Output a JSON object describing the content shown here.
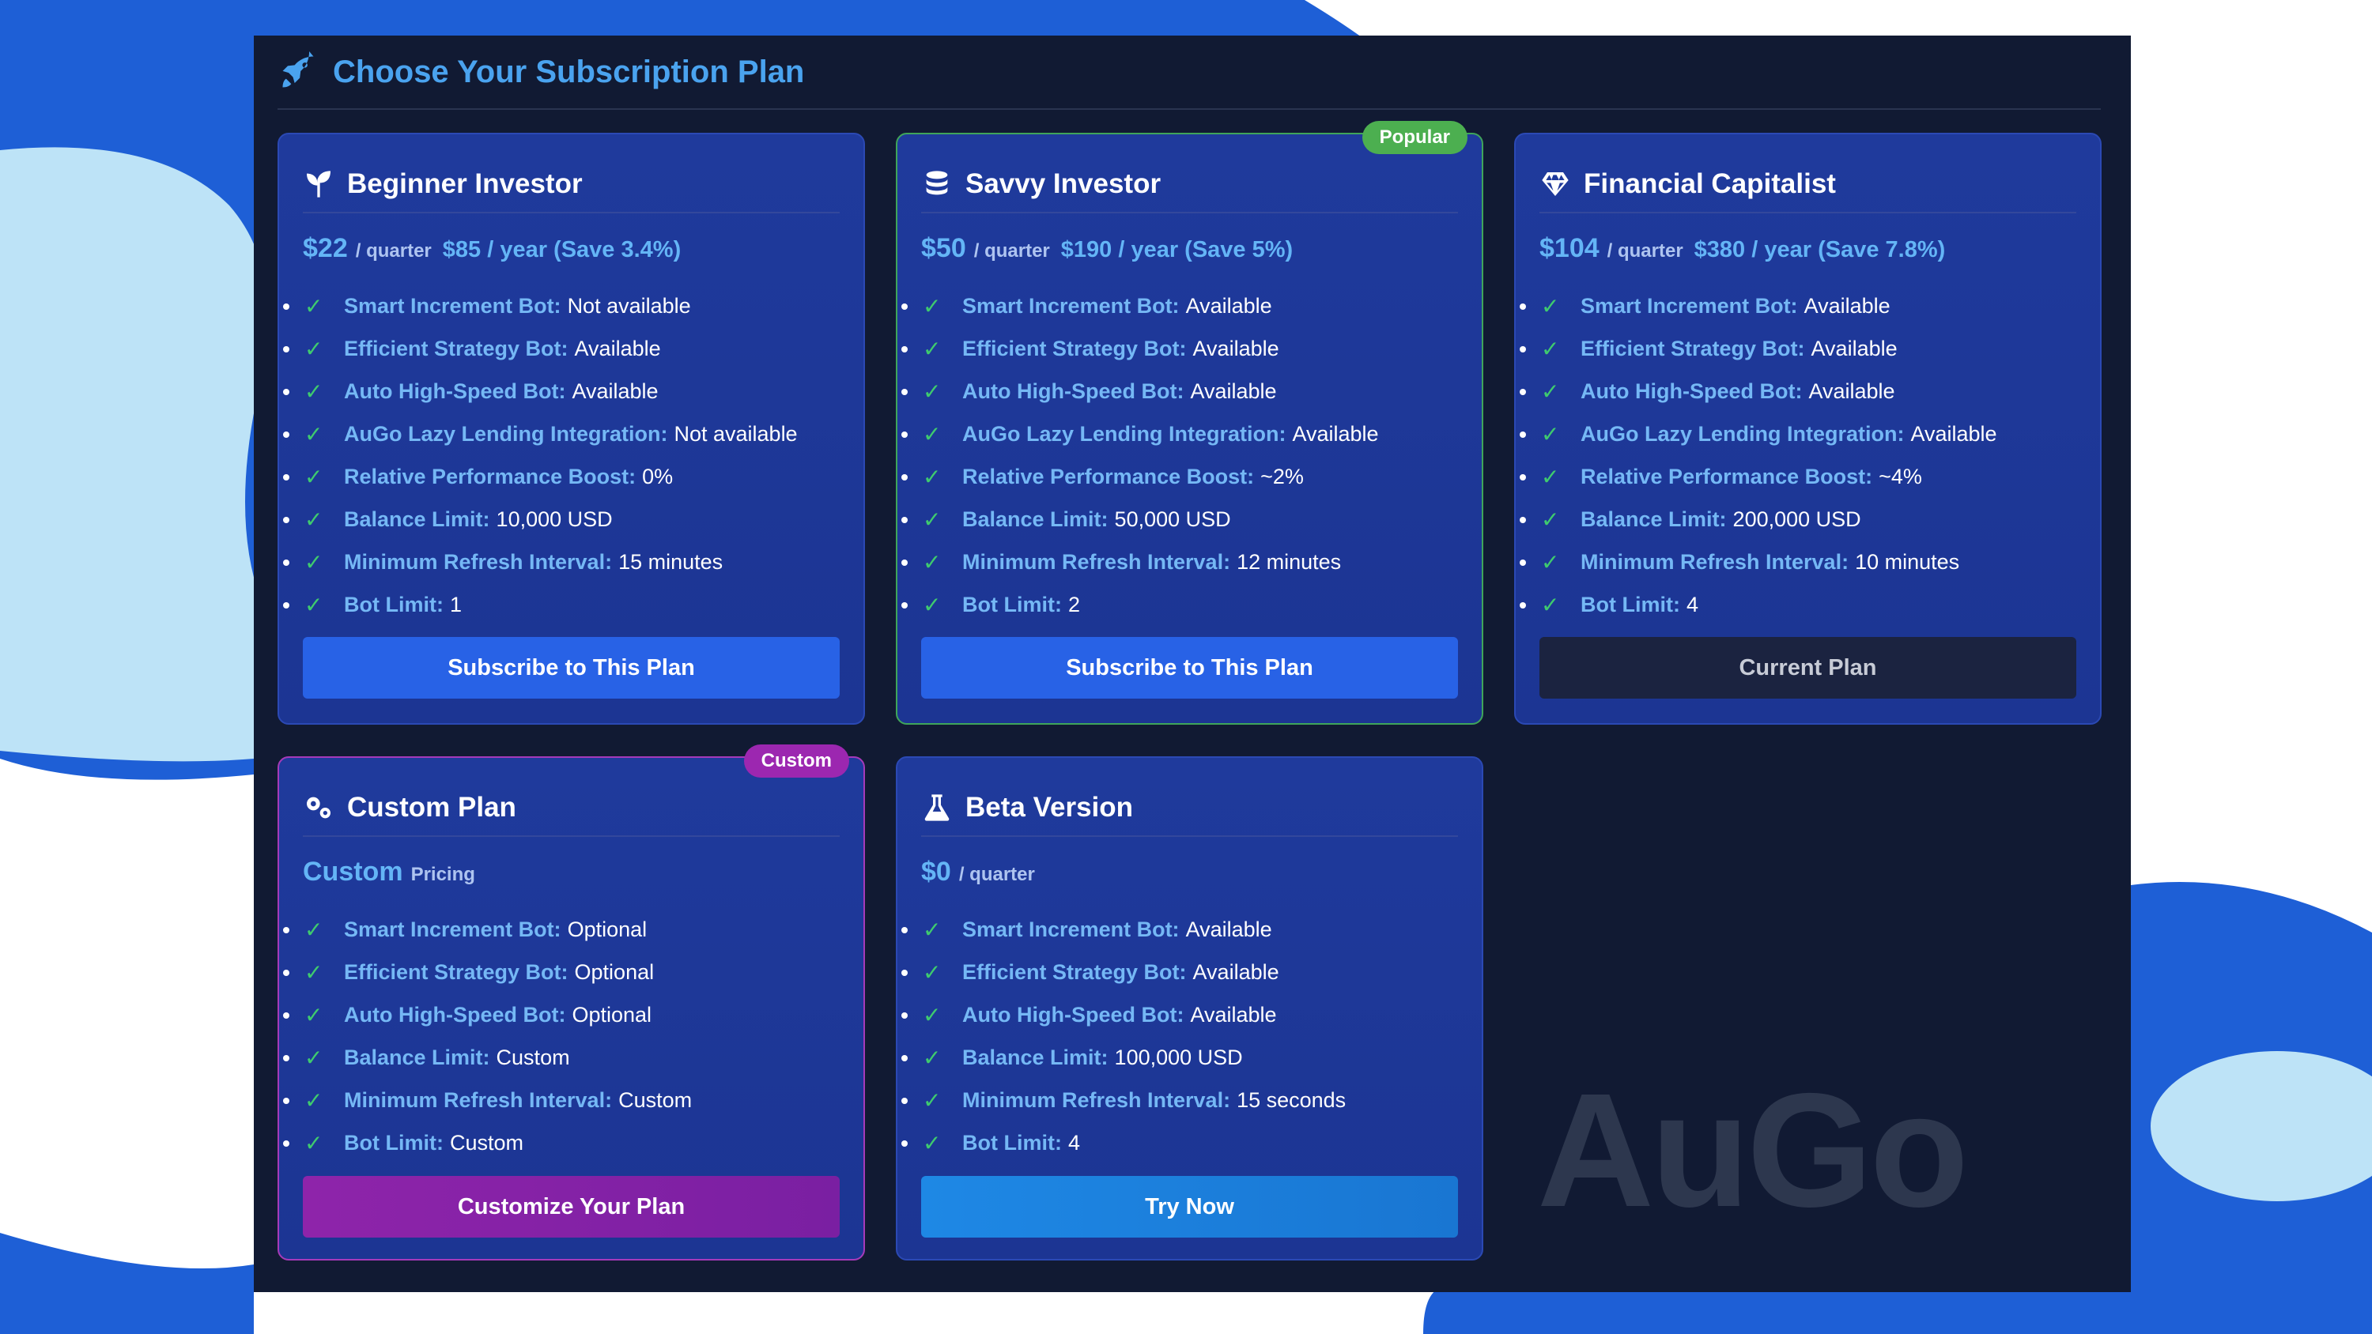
{
  "header": {
    "title": "Choose Your Subscription Plan",
    "icon": "rocket-icon"
  },
  "colors": {
    "accent": "#4aa3ef",
    "card": "#1f3a9c",
    "popular": "#4caf50",
    "custom": "#9c27b0"
  },
  "plans": [
    {
      "title": "Beginner Investor",
      "icon": "seedling-icon",
      "price": "$22",
      "unit": "/ quarter",
      "yearly": "$85 / year (Save 3.4%)",
      "features": [
        {
          "label": "Smart Increment Bot:",
          "value": "Not available"
        },
        {
          "label": "Efficient Strategy Bot:",
          "value": "Available"
        },
        {
          "label": "Auto High-Speed Bot:",
          "value": "Available"
        },
        {
          "label": "AuGo Lazy Lending Integration:",
          "value": "Not available"
        },
        {
          "label": "Relative Performance Boost:",
          "value": "0%"
        },
        {
          "label": "Balance Limit:",
          "value": "10,000 USD"
        },
        {
          "label": "Minimum Refresh Interval:",
          "value": "15 minutes"
        },
        {
          "label": "Bot Limit:",
          "value": "1"
        }
      ],
      "button": "Subscribe to This Plan"
    },
    {
      "title": "Savvy Investor",
      "icon": "coins-icon",
      "badge": "Popular",
      "price": "$50",
      "unit": "/ quarter",
      "yearly": "$190 / year (Save 5%)",
      "features": [
        {
          "label": "Smart Increment Bot:",
          "value": "Available"
        },
        {
          "label": "Efficient Strategy Bot:",
          "value": "Available"
        },
        {
          "label": "Auto High-Speed Bot:",
          "value": "Available"
        },
        {
          "label": "AuGo Lazy Lending Integration:",
          "value": "Available"
        },
        {
          "label": "Relative Performance Boost:",
          "value": "~2%"
        },
        {
          "label": "Balance Limit:",
          "value": "50,000 USD"
        },
        {
          "label": "Minimum Refresh Interval:",
          "value": "12 minutes"
        },
        {
          "label": "Bot Limit:",
          "value": "2"
        }
      ],
      "button": "Subscribe to This Plan"
    },
    {
      "title": "Financial Capitalist",
      "icon": "gem-icon",
      "price": "$104",
      "unit": "/ quarter",
      "yearly": "$380 / year (Save 7.8%)",
      "features": [
        {
          "label": "Smart Increment Bot:",
          "value": "Available"
        },
        {
          "label": "Efficient Strategy Bot:",
          "value": "Available"
        },
        {
          "label": "Auto High-Speed Bot:",
          "value": "Available"
        },
        {
          "label": "AuGo Lazy Lending Integration:",
          "value": "Available"
        },
        {
          "label": "Relative Performance Boost:",
          "value": "~4%"
        },
        {
          "label": "Balance Limit:",
          "value": "200,000 USD"
        },
        {
          "label": "Minimum Refresh Interval:",
          "value": "10 minutes"
        },
        {
          "label": "Bot Limit:",
          "value": "4"
        }
      ],
      "button": "Current Plan"
    },
    {
      "title": "Custom Plan",
      "icon": "cogs-icon",
      "badge": "Custom",
      "price": "Custom",
      "unit": "Pricing",
      "yearly": "",
      "features": [
        {
          "label": "Smart Increment Bot:",
          "value": "Optional"
        },
        {
          "label": "Efficient Strategy Bot:",
          "value": "Optional"
        },
        {
          "label": "Auto High-Speed Bot:",
          "value": "Optional"
        },
        {
          "label": "Balance Limit:",
          "value": "Custom"
        },
        {
          "label": "Minimum Refresh Interval:",
          "value": "Custom"
        },
        {
          "label": "Bot Limit:",
          "value": "Custom"
        }
      ],
      "button": "Customize Your Plan"
    },
    {
      "title": "Beta Version",
      "icon": "flask-icon",
      "price": "$0",
      "unit": "/ quarter",
      "yearly": "",
      "features": [
        {
          "label": "Smart Increment Bot:",
          "value": "Available"
        },
        {
          "label": "Efficient Strategy Bot:",
          "value": "Available"
        },
        {
          "label": "Auto High-Speed Bot:",
          "value": "Available"
        },
        {
          "label": "Balance Limit:",
          "value": "100,000 USD"
        },
        {
          "label": "Minimum Refresh Interval:",
          "value": "15 seconds"
        },
        {
          "label": "Bot Limit:",
          "value": "4"
        }
      ],
      "button": "Try Now"
    }
  ],
  "check_glyph": "✓",
  "watermark": "AuGo"
}
